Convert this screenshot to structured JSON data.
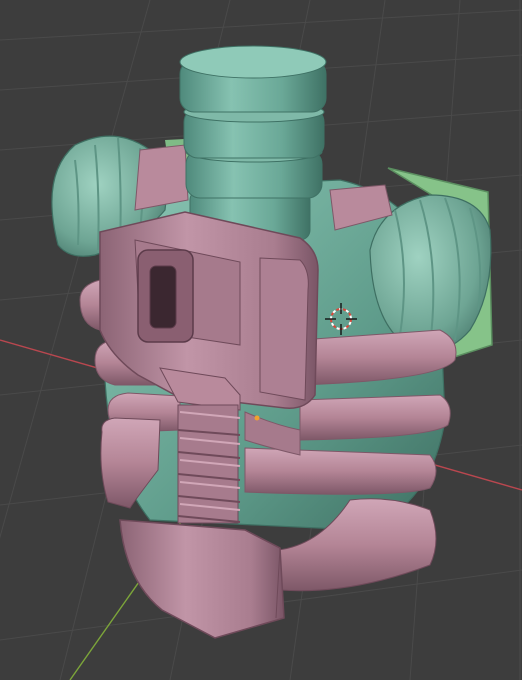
{
  "viewport": {
    "background": "#3d3d3d",
    "grid_color": "#4a4a4a",
    "x_axis_color": "#b9474f",
    "y_axis_color": "#7ca53a"
  },
  "model": {
    "pink_material": "#b98a9c",
    "teal_material": "#79b6a4",
    "green_material": "#86c389"
  },
  "cursor": {
    "icon": "3d-cursor-icon",
    "ring_color": "#d9473a",
    "ring_alt_color": "#ffffff"
  }
}
